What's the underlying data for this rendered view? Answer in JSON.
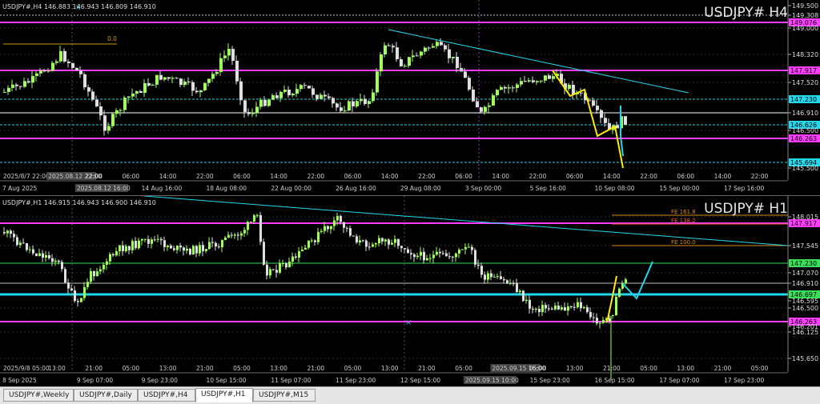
{
  "colors": {
    "up": "#9eff5a",
    "down": "#dfdfdf",
    "magenta": "#ff3cff",
    "cyan": "#23d8ec",
    "green": "#38e05a",
    "yellow": "#ffea00",
    "orange": "#d98a1a",
    "grid": "#2e2e2e"
  },
  "h4": {
    "header": "USDJPY#,H4  146.883 146.943 146.809 146.910",
    "watermark": "USDJPY# H4",
    "prices": [
      {
        "text": "149.500",
        "color": "#ffffff"
      },
      {
        "text": "149.308",
        "color": "#ffffff"
      },
      {
        "text": "149.076",
        "color": "#ff3cff"
      },
      {
        "text": "149.000",
        "color": "#ffffff"
      },
      {
        "text": "148.320",
        "color": "#ffffff"
      },
      {
        "text": "147.917",
        "color": "#ff3cff"
      },
      {
        "text": "147.520",
        "color": "#ffffff"
      },
      {
        "text": "147.230",
        "color": "#23d8ec"
      },
      {
        "text": "146.910",
        "color": "#ffffff"
      },
      {
        "text": "146.626",
        "color": "#23d8ec"
      },
      {
        "text": "146.500",
        "color": "#ffffff"
      },
      {
        "text": "146.263",
        "color": "#ff3cff"
      },
      {
        "text": "145.694",
        "color": "#23d8ec"
      },
      {
        "text": "145.500",
        "color": "#ffffff"
      }
    ],
    "fib_label": "0.0",
    "time_top": [
      "2025/8/7 22:00",
      "2025.08.12 22:00",
      "22:00",
      "06:00",
      "14:00",
      "22:00",
      "06:00",
      "14:00",
      "22:00",
      "06:00",
      "14:00",
      "22:00",
      "06:00",
      "14:00",
      "22:00",
      "06:00",
      "14:00",
      "22:00",
      "06:00",
      "14:00",
      "22:00"
    ],
    "time_bottom": [
      "7 Aug 2025",
      "2025.08.12 16:00",
      "14 Aug 16:00",
      "18 Aug 08:00",
      "22 Aug 00:00",
      "26 Aug 16:00",
      "29 Aug 08:00",
      "3 Sep 00:00",
      "5 Sep 16:00",
      "10 Sep 08:00",
      "15 Sep 00:00",
      "17 Sep 16:00"
    ]
  },
  "h1": {
    "header": "USDJPY#,H1  146.915 146.943 146.900 146.910",
    "watermark": "USDJPY# H1",
    "prices": [
      {
        "text": "148.015",
        "color": "#ffffff"
      },
      {
        "text": "147.917",
        "color": "#ff3cff"
      },
      {
        "text": "147.545",
        "color": "#ffffff"
      },
      {
        "text": "147.230",
        "color": "#38e05a"
      },
      {
        "text": "147.070",
        "color": "#ffffff"
      },
      {
        "text": "146.910",
        "color": "#ffffff"
      },
      {
        "text": "146.697",
        "color": "#38e05a"
      },
      {
        "text": "146.595",
        "color": "#ffffff"
      },
      {
        "text": "146.500",
        "color": "#ffffff"
      },
      {
        "text": "146.263",
        "color": "#ff3cff"
      },
      {
        "text": "146.201",
        "color": "#ffffff"
      },
      {
        "text": "146.125",
        "color": "#ffffff"
      },
      {
        "text": "145.650",
        "color": "#ffffff"
      }
    ],
    "fibs": [
      {
        "text": "FE 161.8",
        "color": "#d98a1a"
      },
      {
        "text": "FE 138.2",
        "color": "#ff5a3c"
      },
      {
        "text": "FE 100.0",
        "color": "#d98a1a"
      }
    ],
    "time_top": [
      "2025/9/8 05:00",
      "13:00",
      "21:00",
      "05:00",
      "13:00",
      "21:00",
      "05:00",
      "13:00",
      "21:00",
      "05:00",
      "13:00",
      "21:00",
      "05:00",
      "2025.09.15 16:00",
      "05:00",
      "13:00",
      "21:00",
      "05:00",
      "13:00",
      "21:00",
      "05:00"
    ],
    "time_bottom": [
      "8 Sep 2025",
      "9 Sep 07:00",
      "9 Sep 23:00",
      "10 Sep 15:00",
      "11 Sep 07:00",
      "11 Sep 23:00",
      "12 Sep 15:00",
      "2025.09.15 10:00",
      "15 Sep 23:00",
      "16 Sep 15:00",
      "17 Sep 07:00",
      "17 Sep 23:00"
    ]
  },
  "tabs": [
    {
      "label": "USDJPY#,Weekly",
      "active": false
    },
    {
      "label": "USDJPY#,Daily",
      "active": false
    },
    {
      "label": "USDJPY#,H4",
      "active": false
    },
    {
      "label": "USDJPY#,H1",
      "active": true
    },
    {
      "label": "USDJPY#,M15",
      "active": false
    }
  ]
}
